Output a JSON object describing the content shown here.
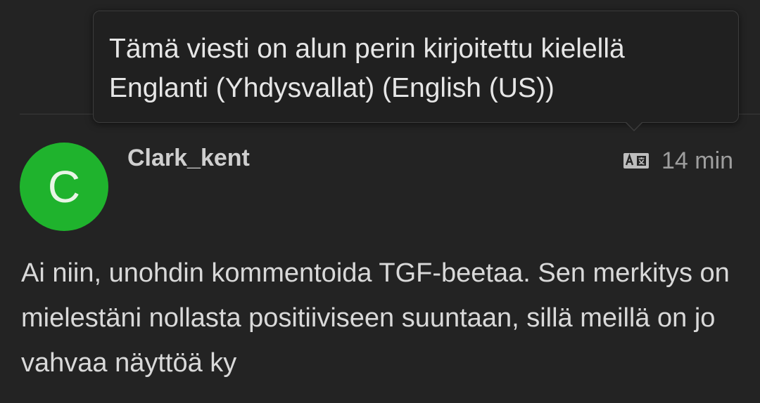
{
  "tooltip": {
    "text": "Tämä viesti on alun perin kirjoitettu kielellä Englanti (Yhdysvallat) (English (US))"
  },
  "post": {
    "avatar_letter": "C",
    "avatar_color": "#1fb32d",
    "username": "Clark_kent",
    "translate_icon": "translate-icon",
    "timestamp": "14 min",
    "body": "Ai niin, unohdin kommentoida TGF-beetaa. Sen merkitys on mielestäni nollasta positiiviseen suuntaan, sillä meillä on jo vahvaa näyttöä ky"
  }
}
